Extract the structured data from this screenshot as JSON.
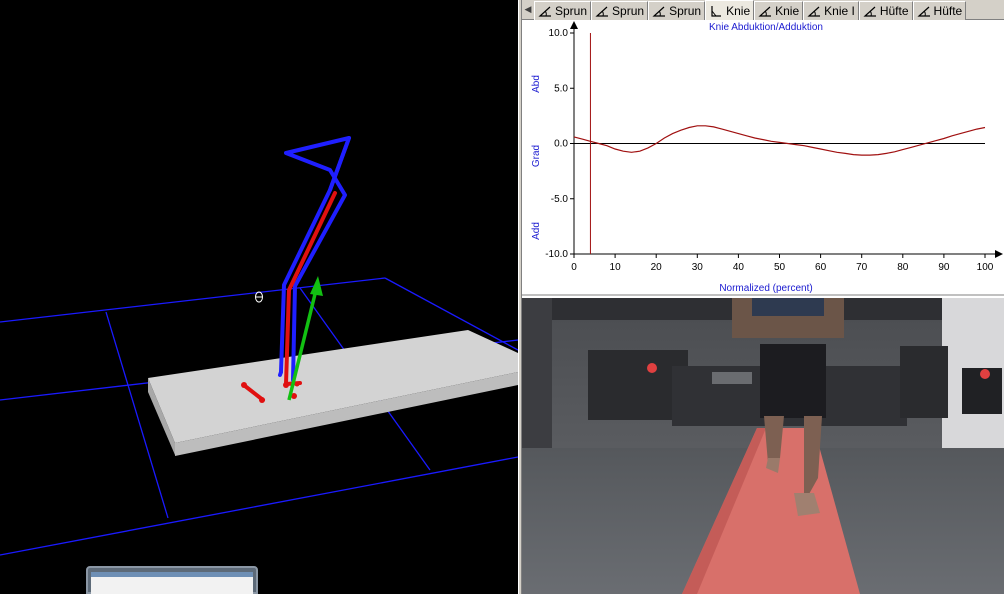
{
  "tabs": [
    {
      "label": "Sprun",
      "icon": "angle-icon",
      "active": false
    },
    {
      "label": "Sprun",
      "icon": "angle-icon",
      "active": false
    },
    {
      "label": "Sprun",
      "icon": "angle-icon",
      "active": false
    },
    {
      "label": "Knie",
      "icon": "knee-angle-icon",
      "active": true
    },
    {
      "label": "Knie",
      "icon": "angle-icon",
      "active": false
    },
    {
      "label": "Knie I",
      "icon": "angle-icon",
      "active": false
    },
    {
      "label": "Hüfte",
      "icon": "angle-icon",
      "active": false
    },
    {
      "label": "Hüfte",
      "icon": "angle-icon",
      "active": false
    }
  ],
  "colors": {
    "grid": "#1a1aff",
    "skeleton_blue": "#1f1fff",
    "skeleton_red": "#e01010",
    "skeleton_green": "#12c012",
    "plate": "#d3d3d3",
    "curve": "#a01010",
    "axis_label": "#1a1ad0"
  },
  "chart_data": {
    "type": "line",
    "title": "Knie Abduktion/Adduktion",
    "xlabel": "Normalized (percent)",
    "ylabel": "Grad",
    "y_annotations": {
      "top": "Abd",
      "bottom": "Add"
    },
    "xlim": [
      0,
      100
    ],
    "ylim": [
      -10,
      10
    ],
    "x_ticks": [
      "0",
      "10",
      "20",
      "30",
      "40",
      "50",
      "60",
      "70",
      "80",
      "90",
      "100"
    ],
    "y_ticks": [
      "10.0",
      "5.0",
      "0.0",
      "-5.0",
      "-10.0"
    ],
    "cursor_x": 4,
    "series": [
      {
        "x": [
          0,
          2,
          4,
          6,
          8,
          10,
          12,
          14,
          16,
          18,
          20,
          22,
          24,
          26,
          28,
          30,
          32,
          34,
          36,
          38,
          40,
          42,
          44,
          46,
          48,
          50,
          52,
          54,
          56,
          58,
          60,
          62,
          64,
          66,
          68,
          70,
          72,
          74,
          76,
          78,
          80,
          82,
          84,
          86,
          88,
          90,
          92,
          94,
          96,
          98,
          100
        ],
        "values": [
          0.6,
          0.4,
          0.2,
          0.0,
          -0.2,
          -0.5,
          -0.7,
          -0.8,
          -0.7,
          -0.4,
          0.0,
          0.5,
          0.9,
          1.2,
          1.45,
          1.6,
          1.6,
          1.5,
          1.3,
          1.1,
          0.9,
          0.7,
          0.5,
          0.35,
          0.2,
          0.1,
          0.0,
          -0.1,
          -0.2,
          -0.35,
          -0.5,
          -0.65,
          -0.8,
          -0.9,
          -1.0,
          -1.05,
          -1.05,
          -1.0,
          -0.9,
          -0.75,
          -0.55,
          -0.35,
          -0.15,
          0.05,
          0.25,
          0.45,
          0.7,
          0.9,
          1.1,
          1.3,
          1.45
        ]
      }
    ]
  }
}
